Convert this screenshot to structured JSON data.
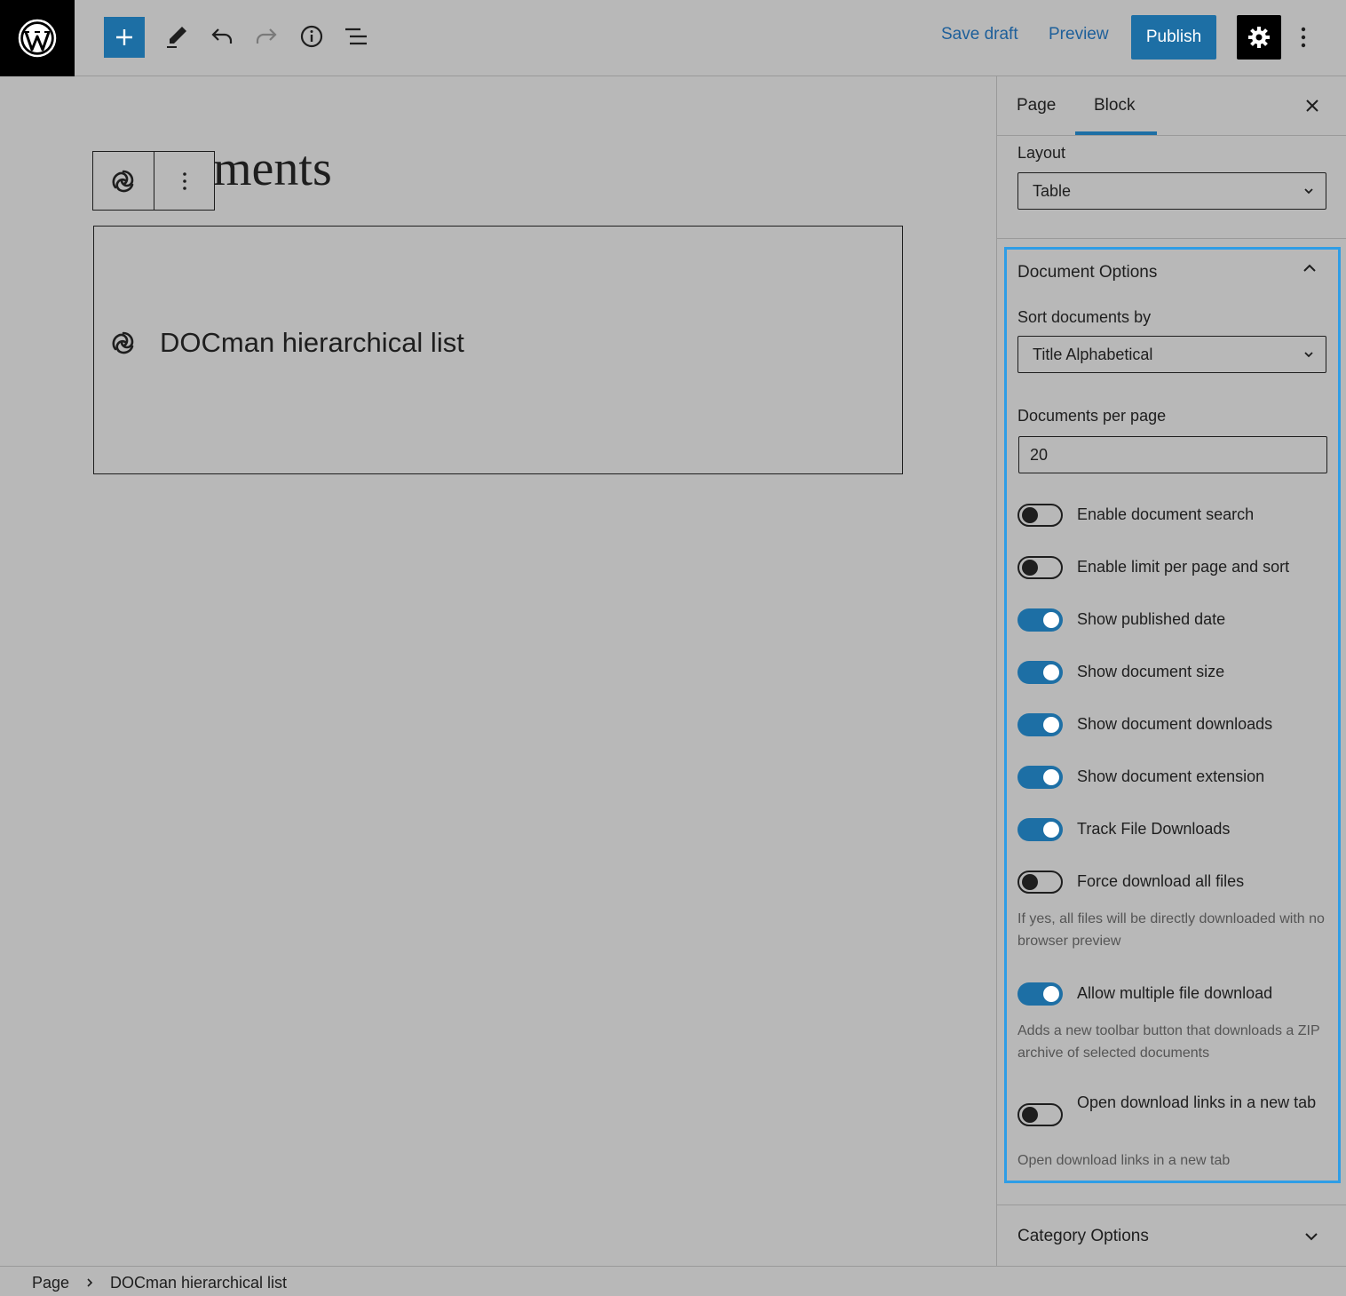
{
  "toolbar": {
    "save_draft": "Save draft",
    "preview": "Preview",
    "publish": "Publish"
  },
  "canvas": {
    "title_fragment": "ments",
    "block_label": "DOCman hierarchical list"
  },
  "sidebar": {
    "tabs": [
      {
        "label": "Page",
        "active": false
      },
      {
        "label": "Block",
        "active": true
      }
    ],
    "layout": {
      "label": "Layout",
      "value": "Table"
    },
    "document_options": {
      "title": "Document Options",
      "sort": {
        "label": "Sort documents by",
        "value": "Title Alphabetical"
      },
      "per_page": {
        "label": "Documents per page",
        "value": "20"
      },
      "toggles": [
        {
          "label": "Enable document search",
          "on": false
        },
        {
          "label": "Enable limit per page and sort",
          "on": false
        },
        {
          "label": "Show published date",
          "on": true
        },
        {
          "label": "Show document size",
          "on": true
        },
        {
          "label": "Show document downloads",
          "on": true
        },
        {
          "label": "Show document extension",
          "on": true
        },
        {
          "label": "Track File Downloads",
          "on": true
        },
        {
          "label": "Force download all files",
          "on": false,
          "help": "If yes, all files will be directly downloaded with no browser preview"
        },
        {
          "label": "Allow multiple file download",
          "on": true,
          "help": "Adds a new toolbar button that downloads a ZIP archive of selected documents"
        },
        {
          "label": "Open download links in a new tab",
          "on": false,
          "help": "Open download links in a new tab"
        }
      ]
    },
    "category_options": {
      "title": "Category Options"
    }
  },
  "breadcrumb": {
    "root": "Page",
    "current": "DOCman hierarchical list"
  },
  "colors": {
    "accent": "#1d6fa5",
    "focus_border": "#2e9de6",
    "background": "#b8b8b8"
  }
}
